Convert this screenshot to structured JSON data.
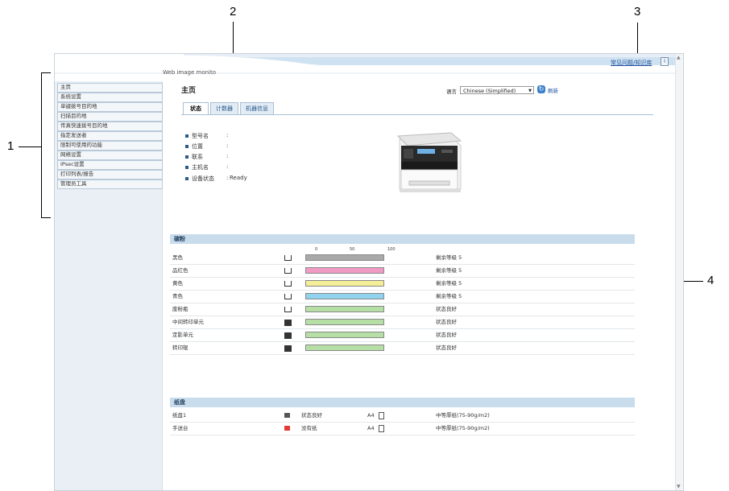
{
  "callouts": [
    "1",
    "2",
    "3",
    "4"
  ],
  "header": {
    "app_title": "Web image monito",
    "help_link": "常见问题/知识库",
    "info_icon_label": "i"
  },
  "sidebar": {
    "items": [
      {
        "label": "主页"
      },
      {
        "label": "系统设置"
      },
      {
        "label": "单键拨号目的地"
      },
      {
        "label": "扫描目的地"
      },
      {
        "label": "传真快速拨号目的地"
      },
      {
        "label": "指定发送者"
      },
      {
        "label": "限制可使用的功能"
      },
      {
        "label": "网络设置"
      },
      {
        "label": "IPsec设置"
      },
      {
        "label": "打印列表/报告"
      },
      {
        "label": "管理员工具"
      }
    ]
  },
  "main": {
    "page_title": "主页",
    "language_label": "语言",
    "language_value": "Chinese (Simplified)",
    "refresh_label": "刷新",
    "tabs": [
      {
        "label": "状态",
        "active": true
      },
      {
        "label": "计数器",
        "active": false
      },
      {
        "label": "机器信息",
        "active": false
      }
    ],
    "device_info": [
      {
        "label": "型号名",
        "sep": ":",
        "value": ""
      },
      {
        "label": "位置",
        "sep": ":",
        "value": ""
      },
      {
        "label": "联系",
        "sep": ":",
        "value": ""
      },
      {
        "label": "主机名",
        "sep": ":",
        "value": ""
      },
      {
        "label": "设备状态",
        "sep": ":",
        "value": "Ready"
      }
    ],
    "toner": {
      "title": "碳粉",
      "scale": [
        "0",
        "50",
        "100"
      ],
      "rows": [
        {
          "name": "黑色",
          "icon": "toner-icon",
          "level": 1.0,
          "color": "#a9a9a9",
          "status": "剩余等级  5"
        },
        {
          "name": "品红色",
          "icon": "toner-icon",
          "level": 1.0,
          "color": "#f19ac3",
          "status": "剩余等级  5"
        },
        {
          "name": "黄色",
          "icon": "toner-icon",
          "level": 1.0,
          "color": "#f4ee96",
          "status": "剩余等级  5"
        },
        {
          "name": "青色",
          "icon": "toner-icon",
          "level": 1.0,
          "color": "#8fd3ee",
          "status": "剩余等级  5"
        },
        {
          "name": "废粉瓶",
          "icon": "waste-toner-icon",
          "level": 1.0,
          "color": "#b6dfa6",
          "status": "状态良好"
        },
        {
          "name": "中间转印单元",
          "icon": "unit-icon",
          "level": 1.0,
          "color": "#b6dfa6",
          "status": "状态良好"
        },
        {
          "name": "定影单元",
          "icon": "unit-icon",
          "level": 1.0,
          "color": "#b6dfa6",
          "status": "状态良好"
        },
        {
          "name": "转印辊",
          "icon": "unit-icon",
          "level": 1.0,
          "color": "#b6dfa6",
          "status": "状态良好"
        }
      ]
    },
    "paper": {
      "title": "纸盘",
      "rows": [
        {
          "name": "纸盘1",
          "icon": "tray-ok-icon",
          "status": "状态良好",
          "size": "A4",
          "type": "中等厚纸(75-90g/m2)"
        },
        {
          "name": "手送台",
          "icon": "tray-empty-icon",
          "status": "没有纸",
          "size": "A4",
          "type": "中等厚纸(75-90g/m2)"
        }
      ]
    }
  }
}
